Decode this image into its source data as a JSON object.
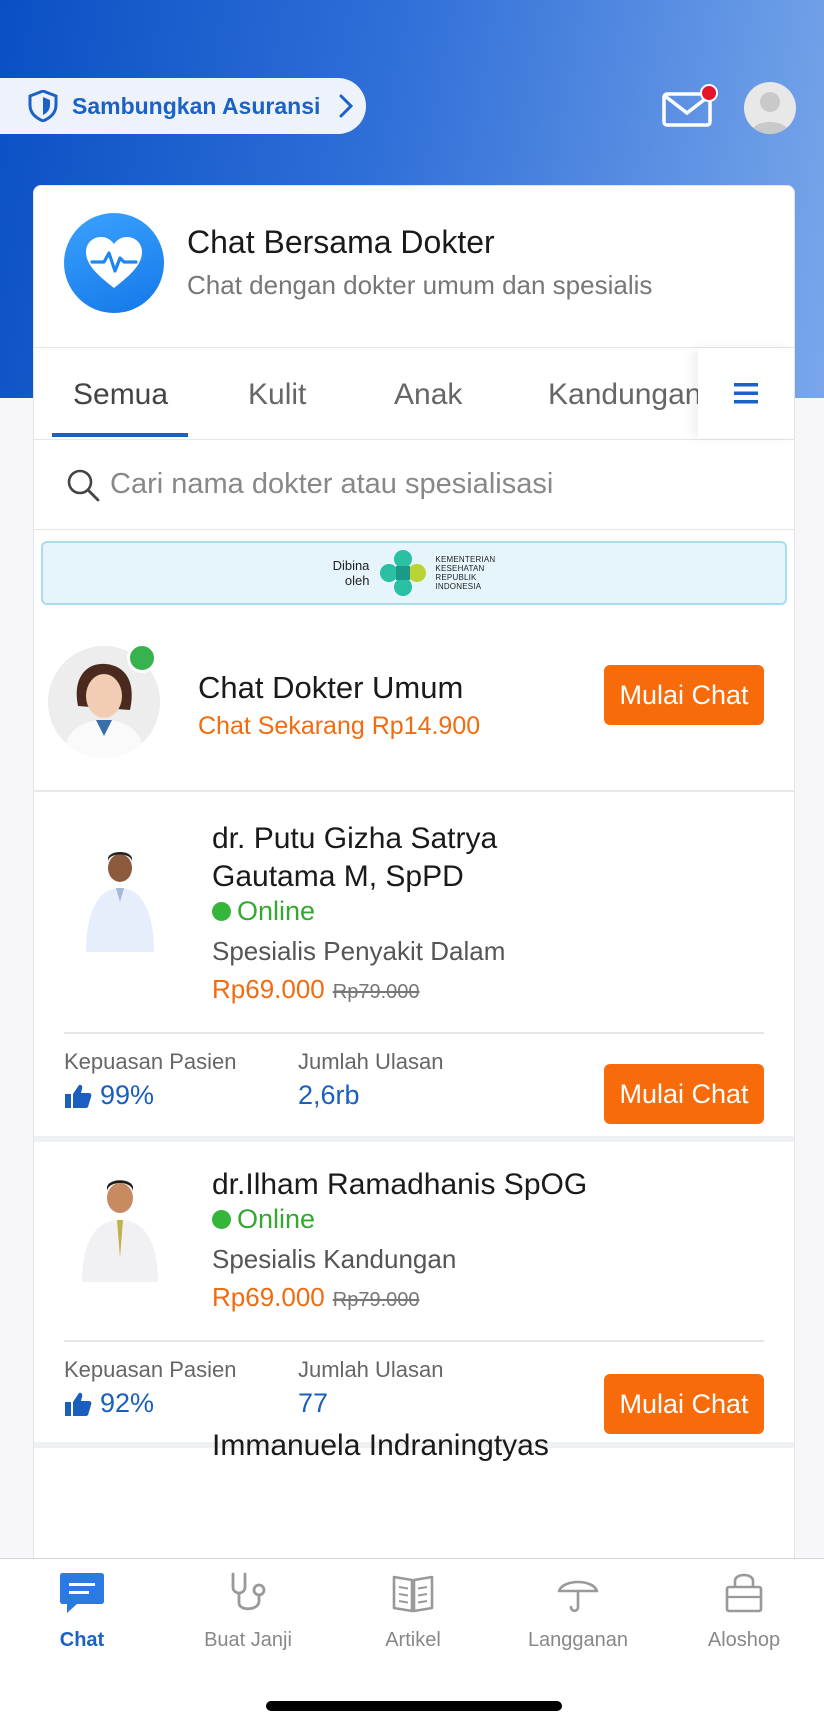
{
  "header": {
    "insurance_label": "Sambungkan Asuransi",
    "colors": {
      "brand_blue": "#1b62c7",
      "notification_dot": "#e5142b"
    }
  },
  "service": {
    "title": "Chat Bersama Dokter",
    "subtitle": "Chat dengan dokter umum dan spesialis"
  },
  "tabs": [
    {
      "label": "Semua",
      "active": true
    },
    {
      "label": "Kulit"
    },
    {
      "label": "Anak"
    },
    {
      "label": "Kandungan"
    }
  ],
  "search": {
    "placeholder": "Cari nama dokter atau spesialisasi"
  },
  "kemenkes": {
    "dibina_line1": "Dibina",
    "dibina_line2": "oleh",
    "org_line1": "KEMENTERIAN",
    "org_line2": "KESEHATAN",
    "org_line3": "REPUBLIK",
    "org_line4": "INDONESIA"
  },
  "umum": {
    "title": "Chat Dokter Umum",
    "price_text": "Chat Sekarang Rp14.900",
    "button": "Mulai Chat"
  },
  "doctors": [
    {
      "name_line1": "dr. Putu Gizha Satrya",
      "name_line2": "Gautama M, SpPD",
      "status": "Online",
      "specialty": "Spesialis Penyakit Dalam",
      "price": "Rp69.000",
      "old_price": "Rp79.000",
      "satisfaction_label": "Kepuasan Pasien",
      "satisfaction": "99%",
      "reviews_label": "Jumlah Ulasan",
      "reviews": "2,6rb",
      "button": "Mulai Chat"
    },
    {
      "name_line1": "dr.Ilham Ramadhanis SpOG",
      "status": "Online",
      "specialty": "Spesialis Kandungan",
      "price": "Rp69.000",
      "old_price": "Rp79.000",
      "satisfaction_label": "Kepuasan Pasien",
      "satisfaction": "92%",
      "reviews_label": "Jumlah Ulasan",
      "reviews": "77",
      "button": "Mulai Chat"
    },
    {
      "name_line1": "Immanuela Indraningtyas"
    }
  ],
  "bottom_nav": [
    {
      "label": "Chat",
      "icon": "chat-bubble-icon",
      "active": true
    },
    {
      "label": "Buat Janji",
      "icon": "stethoscope-icon"
    },
    {
      "label": "Artikel",
      "icon": "book-icon"
    },
    {
      "label": "Langganan",
      "icon": "umbrella-icon"
    },
    {
      "label": "Aloshop",
      "icon": "shopping-bag-icon"
    }
  ]
}
